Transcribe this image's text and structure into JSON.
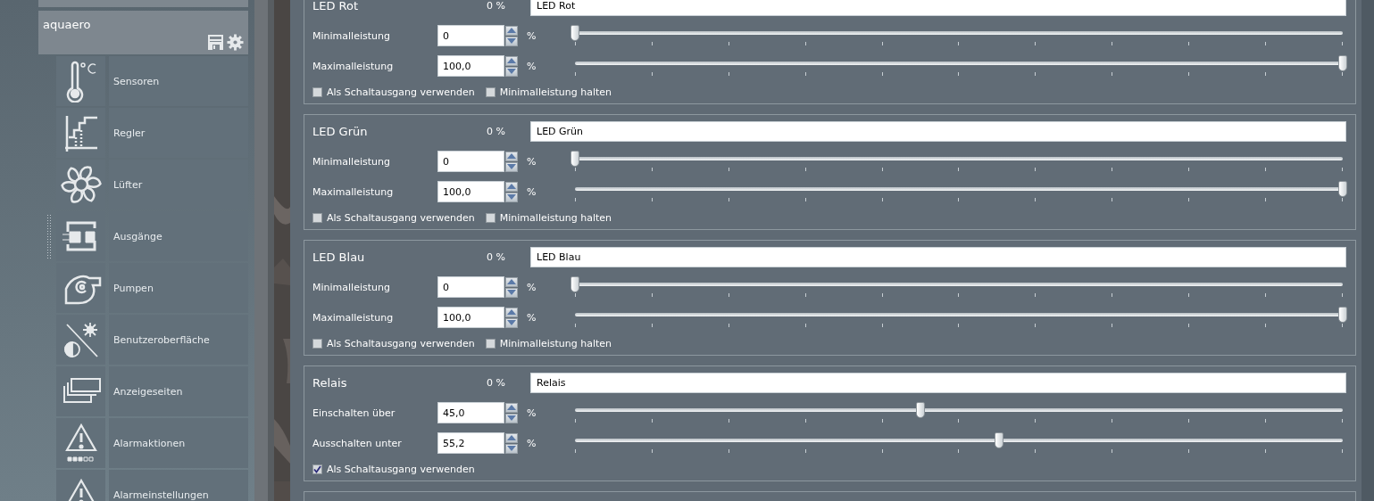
{
  "sidebar": {
    "device": {
      "name": "aquaero"
    },
    "items": [
      {
        "label": "Sensoren"
      },
      {
        "label": "Regler"
      },
      {
        "label": "Lüfter"
      },
      {
        "label": "Ausgänge"
      },
      {
        "label": "Pumpen"
      },
      {
        "label": "Benutzeroberfläche"
      },
      {
        "label": "Anzeigeseiten"
      },
      {
        "label": "Alarmaktionen"
      },
      {
        "label": "Alarmeinstellungen"
      }
    ]
  },
  "groups": [
    {
      "title": "LED Rot",
      "reading": "0 %",
      "name_value": "LED Rot",
      "rows": [
        {
          "label": "Minimalleistung",
          "value": "0",
          "unit": "%",
          "level": 0
        },
        {
          "label": "Maximalleistung",
          "value": "100,0",
          "unit": "%",
          "level": 1
        }
      ],
      "checkboxes": [
        {
          "label": "Als Schaltausgang verwenden",
          "checked": false
        },
        {
          "label": "Minimalleistung halten",
          "checked": false
        }
      ]
    },
    {
      "title": "LED Grün",
      "reading": "0 %",
      "name_value": "LED Grün",
      "rows": [
        {
          "label": "Minimalleistung",
          "value": "0",
          "unit": "%",
          "level": 0
        },
        {
          "label": "Maximalleistung",
          "value": "100,0",
          "unit": "%",
          "level": 1
        }
      ],
      "checkboxes": [
        {
          "label": "Als Schaltausgang verwenden",
          "checked": false
        },
        {
          "label": "Minimalleistung halten",
          "checked": false
        }
      ]
    },
    {
      "title": "LED Blau",
      "reading": "0 %",
      "name_value": "LED Blau",
      "rows": [
        {
          "label": "Minimalleistung",
          "value": "0",
          "unit": "%",
          "level": 0
        },
        {
          "label": "Maximalleistung",
          "value": "100,0",
          "unit": "%",
          "level": 1
        }
      ],
      "checkboxes": [
        {
          "label": "Als Schaltausgang verwenden",
          "checked": false
        },
        {
          "label": "Minimalleistung halten",
          "checked": false
        }
      ]
    },
    {
      "title": "Relais",
      "reading": "0 %",
      "name_value": "Relais",
      "rows": [
        {
          "label": "Einschalten über",
          "value": "45,0",
          "unit": "%",
          "level": 0.45
        },
        {
          "label": "Ausschalten unter",
          "value": "55,2",
          "unit": "%",
          "level": 0.552
        }
      ],
      "checkboxes": [
        {
          "label": "Als Schaltausgang verwenden",
          "checked": true
        }
      ]
    }
  ]
}
